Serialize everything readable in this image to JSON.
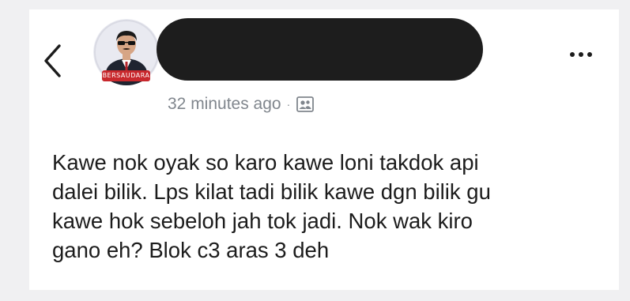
{
  "post": {
    "author_avatar_caption": "BERSAUDARA",
    "timestamp": "32 minutes ago",
    "separator": "·",
    "audience_icon": "friends-icon",
    "more_icon": "more-horizontal-icon",
    "back_icon": "chevron-left-icon",
    "body": "Kawe nok oyak so karo kawe loni takdok api\ndalei bilik. Lps kilat tadi bilik kawe dgn bilik gu\nkawe hok sebeloh jah tok jadi. Nok wak kiro\ngano eh? Blok c3 aras 3 deh"
  },
  "colors": {
    "background": "#f0f0f2",
    "card": "#ffffff",
    "text": "#1c1c1c",
    "meta_text": "#80868d",
    "redaction": "#1d1d1d",
    "avatar_caption_bg": "#c8282d"
  }
}
